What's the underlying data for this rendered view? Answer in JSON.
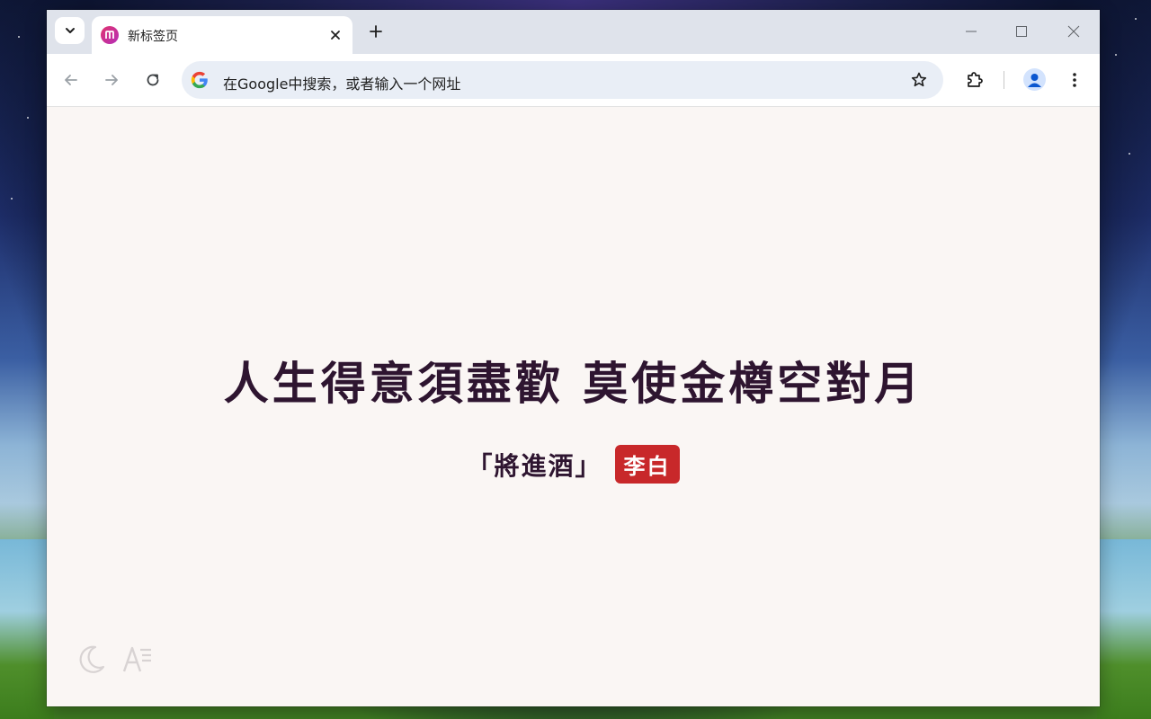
{
  "browser": {
    "tab": {
      "title": "新标签页"
    },
    "omnibox": {
      "placeholder": "在Google中搜索，或者输入一个网址"
    }
  },
  "page": {
    "poem_line": "人生得意須盡歡 莫使金樽空對月",
    "source_title": "「將進酒」",
    "author": "李白"
  },
  "colors": {
    "poem_text": "#2e1530",
    "author_badge": "#c8282a",
    "page_bg": "#faf6f4",
    "tabstrip_bg": "#dfe3eb",
    "omnibox_bg": "#e9eef6"
  },
  "icons": {
    "bottom_left": [
      "moon-icon",
      "font-settings-icon"
    ]
  }
}
